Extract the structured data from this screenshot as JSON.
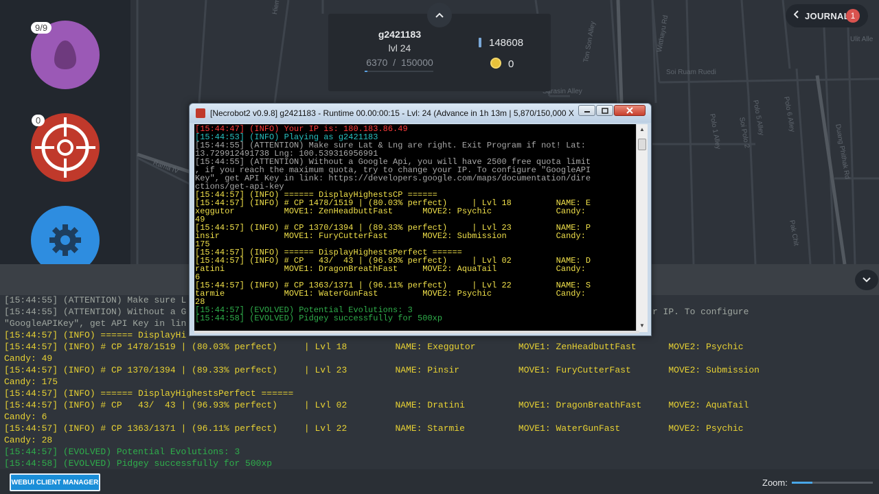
{
  "colors": {
    "egg": "#9b59b6",
    "snipe": "#c0392b",
    "settings": "#2e8de0",
    "accent": "#1a8ed8",
    "journal_badge": "#d9534f",
    "log_info": "#e8d233",
    "log_evolved": "#2fae4b",
    "log_attention": "#9fa6a0",
    "console_error": "#ff3b3b",
    "console_info": "#27c0c0"
  },
  "sidebar": {
    "egg": {
      "badge": "9/9",
      "icon": "egg-icon"
    },
    "snipe": {
      "badge": "0",
      "icon": "crosshair-icon"
    },
    "settings": {
      "icon": "gear-icon"
    }
  },
  "profile": {
    "name": "g2421183",
    "level_label": "lvl 24",
    "xp_current": "6370",
    "xp_separator": "/",
    "xp_needed": "150000",
    "xp_progress": 0.042,
    "stardust": "148608",
    "coins": "0"
  },
  "journal": {
    "label": "JOURNAL",
    "count": "1"
  },
  "map_labels": [
    "Hiem Duan Ra",
    "Soi Ruam Ruedi",
    "Sarasin Alley",
    "Witthayu Rd",
    "Duang Phithak Rd",
    "Rama IV",
    "Ulit Alle",
    "Soi Polo 2",
    "Polo 5 Alley",
    "Polo 6 Alley",
    "Polo 1 Alley",
    "Pak Chit",
    "Ton Son Alley"
  ],
  "background_log": [
    {
      "text": "[15:44:55] (ATTENTION) Make sure L",
      "kind": "attention"
    },
    {
      "text": "[15:44:55] (ATTENTION) Without a G                                                                          to change your IP. To configure",
      "kind": "attention"
    },
    {
      "text": "\"GoogleAPIKey\", get API Key in lin",
      "kind": "attention"
    },
    {
      "text": "[15:44:57] (INFO) ====== DisplayHi",
      "kind": "info"
    },
    {
      "text": "[15:44:57] (INFO) # CP 1478/1519 | (80.03% perfect)     | Lvl 18         NAME: Exeggutor        MOVE1: ZenHeadbuttFast      MOVE2: Psychic",
      "kind": "info"
    },
    {
      "text": "Candy: 49",
      "kind": "info"
    },
    {
      "text": "[15:44:57] (INFO) # CP 1370/1394 | (89.33% perfect)     | Lvl 23         NAME: Pinsir           MOVE1: FuryCutterFast       MOVE2: Submission",
      "kind": "info"
    },
    {
      "text": "Candy: 175",
      "kind": "info"
    },
    {
      "text": "[15:44:57] (INFO) ====== DisplayHighestsPerfect ======",
      "kind": "info"
    },
    {
      "text": "[15:44:57] (INFO) # CP   43/  43 | (96.93% perfect)     | Lvl 02         NAME: Dratini          MOVE1: DragonBreathFast     MOVE2: AquaTail",
      "kind": "info"
    },
    {
      "text": "Candy: 6",
      "kind": "info"
    },
    {
      "text": "[15:44:57] (INFO) # CP 1363/1371 | (96.11% perfect)     | Lvl 22         NAME: Starmie          MOVE1: WaterGunFast         MOVE2: Psychic",
      "kind": "info"
    },
    {
      "text": "Candy: 28",
      "kind": "info"
    },
    {
      "text": "[15:44:57] (EVOLVED) Potential Evolutions: 3",
      "kind": "evolved"
    },
    {
      "text": "[15:44:58] (EVOLVED) Pidgey successfully for 500xp",
      "kind": "evolved"
    }
  ],
  "console": {
    "title": "[Necrobot2 v0.9.8] g2421183 - Runtime 00.00:00:15 - Lvl: 24 (Advance in 1h 13m | 5,870/150,000 X...",
    "minimize_icon": "minimize-icon",
    "maximize_icon": "maximize-icon",
    "close_icon": "close-icon",
    "lines": [
      {
        "text": "[15:44:47] (INFO) Your IP is: 180.183.86.49",
        "kind": "error"
      },
      {
        "text": "[15:44:53] (INFO) Playing as g2421183",
        "kind": "cyan"
      },
      {
        "text": "[15:44:55] (ATTENTION) Make sure Lat & Lng are right. Exit Program if not! Lat:",
        "kind": "attention"
      },
      {
        "text": "13.729912491738 Lng: 100.539316956991",
        "kind": "attention"
      },
      {
        "text": "[15:44:55] (ATTENTION) Without a Google Api, you will have 2500 free quota limit",
        "kind": "attention"
      },
      {
        "text": ", if you reach the maximum quota, try to change your IP. To configure \"GoogleAPI",
        "kind": "attention"
      },
      {
        "text": "Key\", get API Key in link: https://developers.google.com/maps/documentation/dire",
        "kind": "attention"
      },
      {
        "text": "ctions/get-api-key",
        "kind": "attention"
      },
      {
        "text": "[15:44:57] (INFO) ====== DisplayHighestsCP ======",
        "kind": "info"
      },
      {
        "text": "[15:44:57] (INFO) # CP 1478/1519 | (80.03% perfect)     | Lvl 18         NAME: E",
        "kind": "info"
      },
      {
        "text": "xeggutor          MOVE1: ZenHeadbuttFast      MOVE2: Psychic             Candy:",
        "kind": "info"
      },
      {
        "text": "49",
        "kind": "info"
      },
      {
        "text": "[15:44:57] (INFO) # CP 1370/1394 | (89.33% perfect)     | Lvl 23         NAME: P",
        "kind": "info"
      },
      {
        "text": "insir             MOVE1: FuryCutterFast       MOVE2: Submission          Candy:",
        "kind": "info"
      },
      {
        "text": "175",
        "kind": "info"
      },
      {
        "text": "[15:44:57] (INFO) ====== DisplayHighestsPerfect ======",
        "kind": "info"
      },
      {
        "text": "[15:44:57] (INFO) # CP   43/  43 | (96.93% perfect)     | Lvl 02         NAME: D",
        "kind": "info"
      },
      {
        "text": "ratini            MOVE1: DragonBreathFast     MOVE2: AquaTail            Candy:",
        "kind": "info"
      },
      {
        "text": "6",
        "kind": "info"
      },
      {
        "text": "[15:44:57] (INFO) # CP 1363/1371 | (96.11% perfect)     | Lvl 22         NAME: S",
        "kind": "info"
      },
      {
        "text": "tarmie            MOVE1: WaterGunFast         MOVE2: Psychic             Candy:",
        "kind": "info"
      },
      {
        "text": "28",
        "kind": "info"
      },
      {
        "text": "[15:44:57] (EVOLVED) Potential Evolutions: 3",
        "kind": "evolved"
      },
      {
        "text": "[15:44:58] (EVOLVED) Pidgey successfully for 500xp",
        "kind": "evolved"
      }
    ]
  },
  "bottom": {
    "client_manager_label": "WEBUI CLIENT MANAGER",
    "zoom_label": "Zoom:",
    "zoom_level": 0.25
  }
}
